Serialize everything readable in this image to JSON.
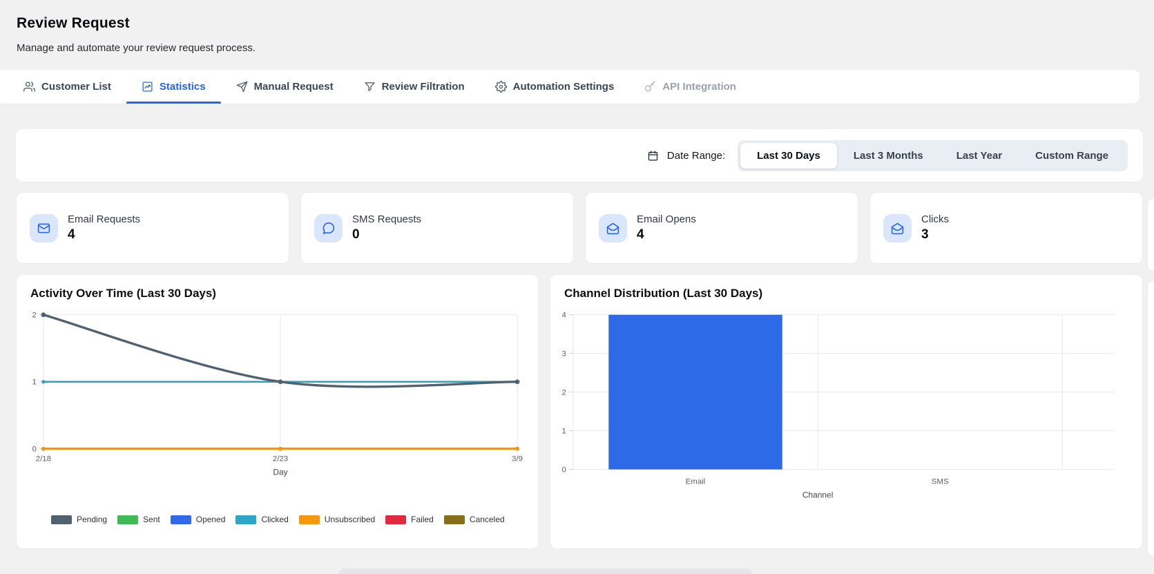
{
  "page": {
    "title": "Review Request",
    "subtitle": "Manage and automate your review request process."
  },
  "tabs": [
    {
      "label": "Customer List",
      "icon": "users-icon",
      "state": "default"
    },
    {
      "label": "Statistics",
      "icon": "line-chart-icon",
      "state": "active"
    },
    {
      "label": "Manual Request",
      "icon": "send-icon",
      "state": "default"
    },
    {
      "label": "Review Filtration",
      "icon": "funnel-icon",
      "state": "default"
    },
    {
      "label": "Automation Settings",
      "icon": "gear-icon",
      "state": "default"
    },
    {
      "label": "API Integration",
      "icon": "key-icon",
      "state": "disabled"
    }
  ],
  "date_range": {
    "label": "Date Range:",
    "icon": "calendar-icon",
    "options": [
      "Last 30 Days",
      "Last 3 Months",
      "Last Year",
      "Custom Range"
    ],
    "selected": "Last 30 Days"
  },
  "stats": [
    {
      "label": "Email Requests",
      "value": "4",
      "icon": "mail-icon"
    },
    {
      "label": "SMS Requests",
      "value": "0",
      "icon": "chat-bubble-icon"
    },
    {
      "label": "Email Opens",
      "value": "4",
      "icon": "mail-open-icon"
    },
    {
      "label": "Clicks",
      "value": "3",
      "icon": "mail-open-icon"
    }
  ],
  "colors": {
    "accent": "#2563eb",
    "stat_icon_bg": "#d9e6fb",
    "page_bg": "#f1f1f2",
    "card_bg": "#ffffff",
    "grid": "#e7e7e8"
  },
  "chart_data": [
    {
      "type": "line",
      "title": "Activity Over Time (Last 30 Days)",
      "xlabel": "Day",
      "x": [
        "2/18",
        "2/23",
        "3/9"
      ],
      "ylim": [
        0,
        2
      ],
      "yticks": [
        0,
        1,
        2
      ],
      "grid": true,
      "legend_position": "bottom",
      "series": [
        {
          "name": "Pending",
          "color": "#516170",
          "values": [
            2,
            1,
            1
          ]
        },
        {
          "name": "Sent",
          "color": "#3fba55",
          "values": [
            0,
            0,
            0
          ]
        },
        {
          "name": "Opened",
          "color": "#2f6ae8",
          "values": [
            0,
            0,
            0
          ]
        },
        {
          "name": "Clicked",
          "color": "#2fa6c8",
          "values": [
            1,
            1,
            1
          ]
        },
        {
          "name": "Unsubscribed",
          "color": "#f6980e",
          "values": [
            0,
            0,
            0
          ]
        },
        {
          "name": "Failed",
          "color": "#e02b3f",
          "values": [
            0,
            0,
            0
          ]
        },
        {
          "name": "Canceled",
          "color": "#8a6d1a",
          "values": [
            0,
            0,
            0
          ]
        }
      ]
    },
    {
      "type": "bar",
      "title": "Channel Distribution (Last 30 Days)",
      "xlabel": "Channel",
      "categories": [
        "Email",
        "SMS"
      ],
      "values": [
        4,
        0
      ],
      "ylim": [
        0,
        4
      ],
      "yticks": [
        0,
        1,
        2,
        3,
        4
      ],
      "grid": true,
      "bar_color": "#2e6ae8"
    }
  ]
}
